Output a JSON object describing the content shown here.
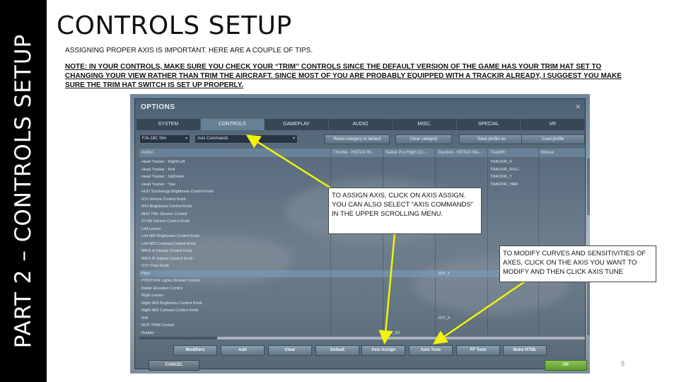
{
  "slide": {
    "side_title": "PART 2 – CONTROLS SETUP",
    "title": "CONTROLS SETUP",
    "subtitle": "ASSIGNING PROPER AXIS IS IMPORTANT. HERE ARE A COUPLE OF TIPS.",
    "note": "NOTE: IN YOUR CONTROLS, MAKE SURE YOU CHECK YOUR “TRIM” CONTROLS SINCE THE DEFAULT VERSION OF THE GAME HAS YOUR TRIM HAT SET TO CHANGING YOUR VIEW RATHER THAN TRIM THE AIRCRAFT. SINCE MOST OF YOU ARE PROBABLY EQUIPPED WITH A TRACKIR ALREADY, I SUGGEST YOU MAKE SURE THE TRIM HAT SWITCH IS SET UP PROPERLY.",
    "page_number": "5"
  },
  "callouts": {
    "axis_assign": "TO ASSIGN AXIS, CLICK ON AXIS ASSIGN. YOU CAN ALSO SELECT “AXIS COMMANDS” IN THE UPPER SCROLLING MENU.",
    "axis_tune": "TO MODIFY CURVES AND SENSITIVITIES OF AXES, CLICK ON THE AXIS YOU WANT TO MODIFY AND THEN CLICK AXIS TUNE"
  },
  "options_window": {
    "title": "OPTIONS",
    "close_icon": "close-icon",
    "tabs": [
      "SYSTEM",
      "CONTROLS",
      "GAMEPLAY",
      "AUDIO",
      "MISC.",
      "SPECIAL",
      "VR"
    ],
    "active_tab": "CONTROLS",
    "aircraft_select": "F/A-18C Sim",
    "category_select": "Axis Commands",
    "top_buttons": [
      "Reset category to default",
      "Clear category",
      "Save profile as",
      "Load profile"
    ],
    "columns": [
      "Action",
      "Throttle - HOTAS W...",
      "Saitek Pro Flight Co...",
      "Joystick - HOTAS Wa...",
      "TrackIR",
      "Mouse"
    ],
    "rows": [
      {
        "action": "Head Tracker : Right/Left",
        "throttle": "",
        "saitek": "",
        "joystick": "",
        "trackir": "TRACKIR_X",
        "mouse": ""
      },
      {
        "action": "Head Tracker : Roll",
        "throttle": "",
        "saitek": "",
        "joystick": "",
        "trackir": "TRACKIR_ROLL",
        "mouse": ""
      },
      {
        "action": "Head Tracker : Up/Down",
        "throttle": "",
        "saitek": "",
        "joystick": "",
        "trackir": "TRACKIR_Y",
        "mouse": ""
      },
      {
        "action": "Head Tracker : Yaw",
        "throttle": "",
        "saitek": "",
        "joystick": "",
        "trackir": "TRACKIR_YAW",
        "mouse": ""
      },
      {
        "action": "HUD Symbology Brightness Control Knob",
        "throttle": "",
        "saitek": "",
        "joystick": "",
        "trackir": "",
        "mouse": ""
      },
      {
        "action": "ICS Volume Control Knob",
        "throttle": "",
        "saitek": "",
        "joystick": "",
        "trackir": "",
        "mouse": ""
      },
      {
        "action": "IFEI Brightness Control Knob",
        "throttle": "",
        "saitek": "",
        "joystick": "",
        "trackir": "",
        "mouse": ""
      },
      {
        "action": "INST PNL Dimmer Control",
        "throttle": "",
        "saitek": "",
        "joystick": "",
        "trackir": "",
        "mouse": ""
      },
      {
        "action": "KY-58 Volume Control Knob",
        "throttle": "",
        "saitek": "",
        "joystick": "",
        "trackir": "",
        "mouse": ""
      },
      {
        "action": "Left Louver",
        "throttle": "",
        "saitek": "",
        "joystick": "",
        "trackir": "",
        "mouse": ""
      },
      {
        "action": "Left MDI Brightness Control Knob",
        "throttle": "",
        "saitek": "",
        "joystick": "",
        "trackir": "",
        "mouse": ""
      },
      {
        "action": "Left MDI Contrast Control Knob",
        "throttle": "",
        "saitek": "",
        "joystick": "",
        "trackir": "",
        "mouse": ""
      },
      {
        "action": "MIDS A Volume Control Knob",
        "throttle": "",
        "saitek": "",
        "joystick": "",
        "trackir": "",
        "mouse": ""
      },
      {
        "action": "MIDS B Volume Control Knob",
        "throttle": "",
        "saitek": "",
        "joystick": "",
        "trackir": "",
        "mouse": ""
      },
      {
        "action": "OXY Flow Knob",
        "throttle": "",
        "saitek": "",
        "joystick": "",
        "trackir": "",
        "mouse": ""
      },
      {
        "action": "Pitch",
        "throttle": "",
        "saitek": "",
        "joystick": "JOY_Y",
        "trackir": "",
        "mouse": ""
      },
      {
        "action": "POSITION Lights Dimmer Control",
        "throttle": "",
        "saitek": "",
        "joystick": "",
        "trackir": "",
        "mouse": ""
      },
      {
        "action": "Radar Elevation Control",
        "throttle": "",
        "saitek": "",
        "joystick": "",
        "trackir": "",
        "mouse": ""
      },
      {
        "action": "Right Louver",
        "throttle": "",
        "saitek": "",
        "joystick": "",
        "trackir": "",
        "mouse": ""
      },
      {
        "action": "Right MDI Brightness Control Knob",
        "throttle": "",
        "saitek": "",
        "joystick": "",
        "trackir": "",
        "mouse": ""
      },
      {
        "action": "Right MDI Contrast Control Knob",
        "throttle": "",
        "saitek": "",
        "joystick": "",
        "trackir": "",
        "mouse": ""
      },
      {
        "action": "Roll",
        "throttle": "",
        "saitek": "",
        "joystick": "JOY_X",
        "trackir": "",
        "mouse": ""
      },
      {
        "action": "RUD TRIM Control",
        "throttle": "",
        "saitek": "",
        "joystick": "",
        "trackir": "",
        "mouse": ""
      },
      {
        "action": "Rudder",
        "throttle": "",
        "saitek": "JOY_RZ",
        "joystick": "",
        "trackir": "",
        "mouse": ""
      }
    ],
    "selected_row": "Pitch",
    "bottom_buttons": [
      "Modifiers",
      "Add",
      "Clear",
      "Default",
      "Axis Assign",
      "Axis Tune",
      "FF Tune",
      "Make HTML"
    ],
    "cancel_label": "CANCEL",
    "ok_label": "OK"
  },
  "colors": {
    "sidebar": "#000000",
    "arrow": "#f2f20a",
    "ok_button": "#6fae3e"
  }
}
